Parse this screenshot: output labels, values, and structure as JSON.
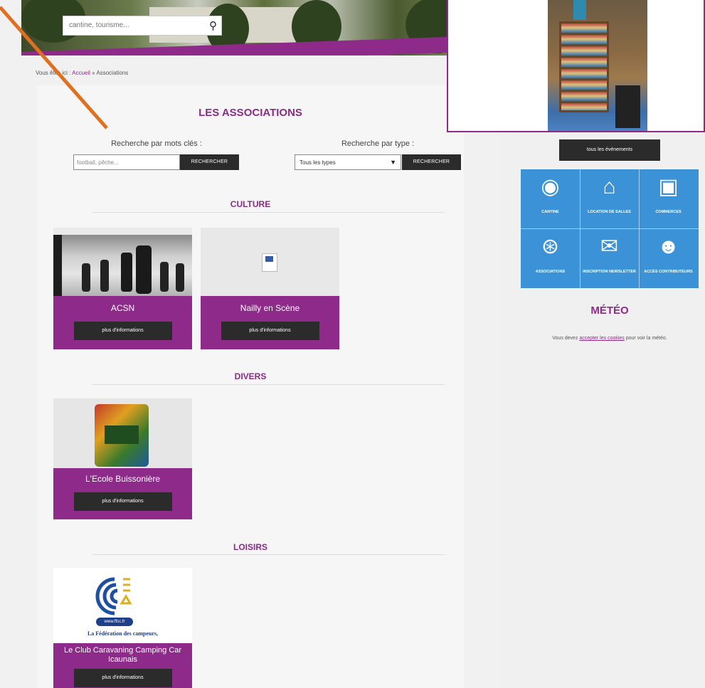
{
  "header": {
    "search_placeholder": "cantine, tourisme..."
  },
  "breadcrumb": {
    "prefix": "Vous êtes ici : ",
    "home": "Accueil",
    "separator": " » ",
    "current": "Associations"
  },
  "main": {
    "title": "LES ASSOCIATIONS",
    "keyword_label": "Recherche par mots clés :",
    "keyword_placeholder": "football, pêche...",
    "type_label": "Recherche par type :",
    "type_selected": "Tous les types",
    "search_button": "RECHERCHER",
    "sections": [
      {
        "title": "CULTURE",
        "cards": [
          {
            "name": "ACSN",
            "button": "plus d'informations"
          },
          {
            "name": "Nailly en Scène",
            "button": "plus d'informations"
          }
        ]
      },
      {
        "title": "DIVERS",
        "cards": [
          {
            "name": "L'Ecole Buissonière",
            "button": "plus d'informations"
          }
        ]
      },
      {
        "title": "LOISIRS",
        "cards": [
          {
            "name": "Le Club Caravaning Camping Car Icaunais",
            "button": "plus d'informations",
            "logo_text": "www.ffcc.fr",
            "logo_caption": "La Fédération des campeurs,"
          }
        ]
      }
    ]
  },
  "sidebar": {
    "events_button": "tous les événements",
    "tiles": [
      {
        "label": "CANTINE",
        "icon": "plate-cutlery-icon"
      },
      {
        "label": "LOCATION DE SALLES",
        "icon": "house-icon"
      },
      {
        "label": "COMMERCES",
        "icon": "shopping-bag-icon"
      },
      {
        "label": "ASSOCIATIONS",
        "icon": "people-network-icon"
      },
      {
        "label": "INSCRIPTION NEWSLETTER",
        "icon": "envelope-icon"
      },
      {
        "label": "ACCÈS CONTRIBUTEURS",
        "icon": "user-lock-icon"
      }
    ],
    "meteo": {
      "title": "MÉTÉO",
      "text_before": "Vous devez ",
      "link": "accepter les cookies",
      "text_after": " pour voir la météo."
    }
  },
  "colors": {
    "brand_purple": "#8e2a89",
    "tile_blue": "#3b92d6",
    "button_dark": "#2b2b2b",
    "annotation_arrow": "#e07020"
  }
}
